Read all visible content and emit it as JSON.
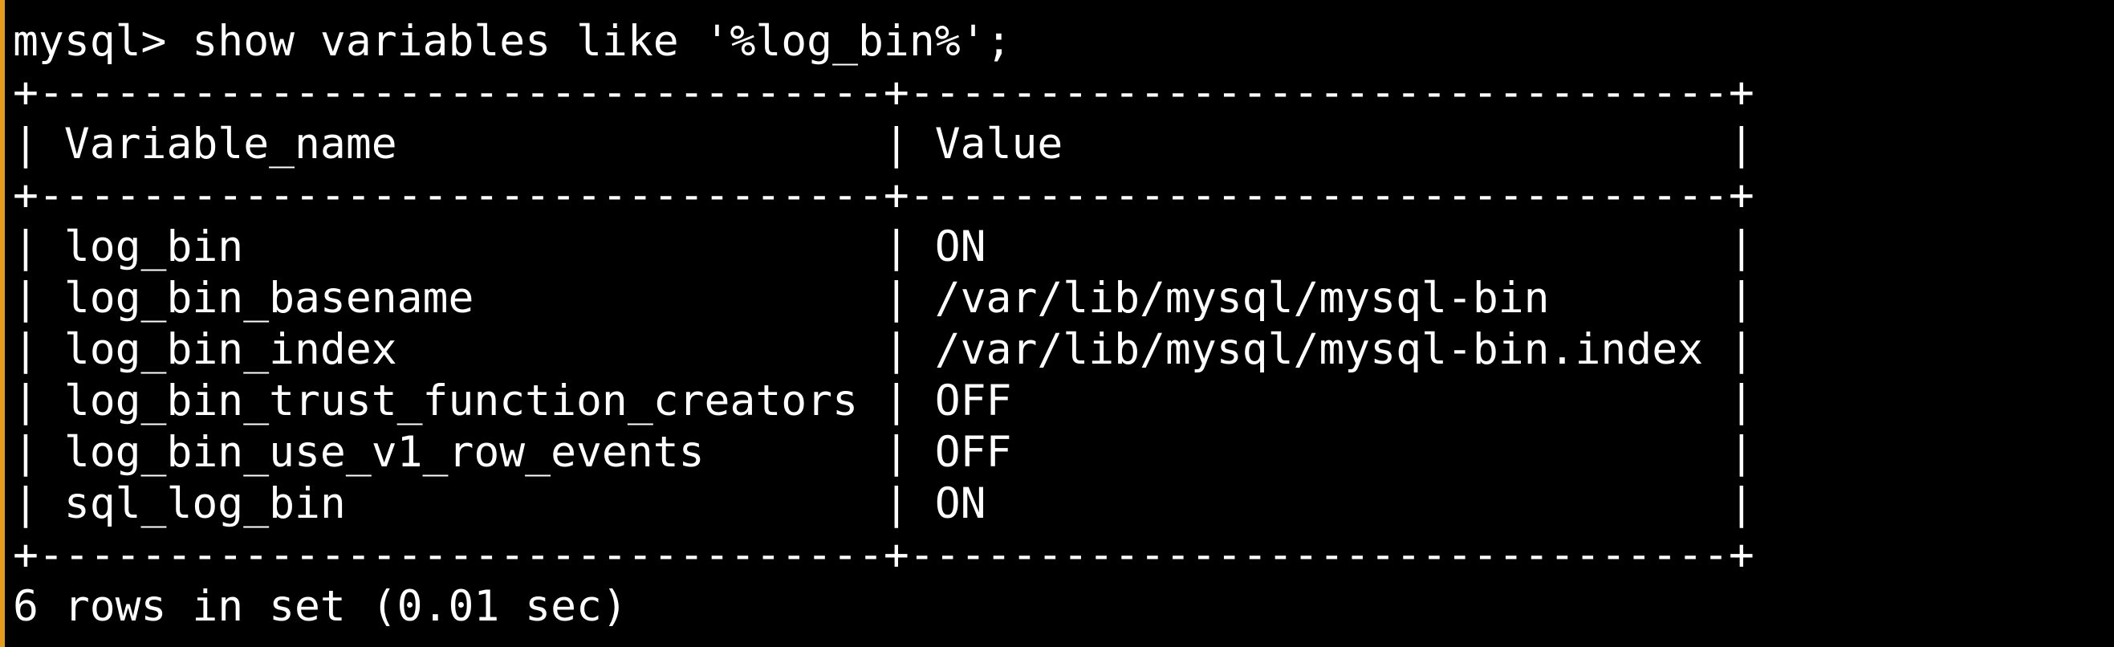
{
  "terminal": {
    "accent_color": "#e39b1c",
    "prompt": "mysql> ",
    "command": "show variables like '%log_bin%';",
    "table": {
      "headers": [
        "Variable_name",
        "Value"
      ],
      "rows": [
        [
          "log_bin",
          "ON"
        ],
        [
          "log_bin_basename",
          "/var/lib/mysql/mysql-bin"
        ],
        [
          "log_bin_index",
          "/var/lib/mysql/mysql-bin.index"
        ],
        [
          "log_bin_trust_function_creators",
          "OFF"
        ],
        [
          "log_bin_use_v1_row_events",
          "OFF"
        ],
        [
          "sql_log_bin",
          "ON"
        ]
      ]
    },
    "result_summary": "6 rows in set (0.01 sec)"
  }
}
